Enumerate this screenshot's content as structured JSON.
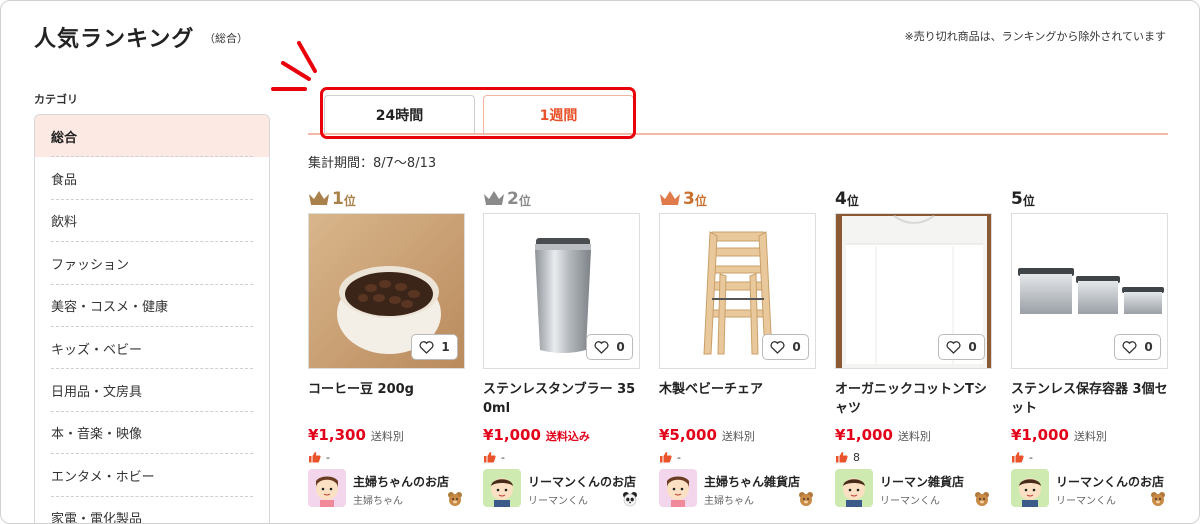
{
  "header": {
    "title": "人気ランキング",
    "subtitle": "（総合）",
    "notice": "※売り切れ商品は、ランキングから除外されています"
  },
  "sidebar": {
    "heading": "カテゴリ",
    "items": [
      {
        "label": "総合",
        "active": true
      },
      {
        "label": "食品"
      },
      {
        "label": "飲料"
      },
      {
        "label": "ファッション"
      },
      {
        "label": "美容・コスメ・健康"
      },
      {
        "label": "キッズ・ベビー"
      },
      {
        "label": "日用品・文房具"
      },
      {
        "label": "本・音楽・映像"
      },
      {
        "label": "エンタメ・ホビー"
      },
      {
        "label": "家電・電化製品"
      }
    ]
  },
  "tabs": [
    {
      "label": "24時間",
      "active": false
    },
    {
      "label": "1週間",
      "active": true
    }
  ],
  "period": "集計期間：8/7〜8/13",
  "products": [
    {
      "rank": "1",
      "rank_suffix": "位",
      "crown": "gold",
      "name": "コーヒー豆 200g",
      "likes": "1",
      "price": "¥1,300",
      "shipping": "送料別",
      "shipping_included": false,
      "rating": "-",
      "shop_name": "主婦ちゃんのお店",
      "shop_owner": "主婦ちゃん",
      "image": "coffee-beans-bowl",
      "avatar_bg": "#f3d6ec"
    },
    {
      "rank": "2",
      "rank_suffix": "位",
      "crown": "silver",
      "name": "ステンレスタンブラー 350ml",
      "likes": "0",
      "price": "¥1,000",
      "shipping": "送料込み",
      "shipping_included": true,
      "rating": "-",
      "shop_name": "リーマンくんのお店",
      "shop_owner": "リーマンくん",
      "image": "stainless-tumbler",
      "avatar_bg": "#cfeab0"
    },
    {
      "rank": "3",
      "rank_suffix": "位",
      "crown": "bronze",
      "name": "木製ベビーチェア",
      "likes": "0",
      "price": "¥5,000",
      "shipping": "送料別",
      "shipping_included": false,
      "rating": "-",
      "shop_name": "主婦ちゃん雑貨店",
      "shop_owner": "主婦ちゃん",
      "image": "wooden-baby-chair",
      "avatar_bg": "#f3d6ec"
    },
    {
      "rank": "4",
      "rank_suffix": "位",
      "crown": "none",
      "name": "オーガニックコットンTシャツ",
      "likes": "0",
      "price": "¥1,000",
      "shipping": "送料別",
      "shipping_included": false,
      "rating": "8",
      "shop_name": "リーマン雑貨店",
      "shop_owner": "リーマンくん",
      "image": "white-tshirt",
      "avatar_bg": "#cfeab0"
    },
    {
      "rank": "5",
      "rank_suffix": "位",
      "crown": "none",
      "name": "ステンレス保存容器 3個セット",
      "likes": "0",
      "price": "¥1,000",
      "shipping": "送料別",
      "shipping_included": false,
      "rating": "-",
      "shop_name": "リーマンくんのお店",
      "shop_owner": "リーマンくん",
      "image": "stainless-containers",
      "avatar_bg": "#cfeab0"
    }
  ],
  "colors": {
    "accent": "#e8532b",
    "highlight": "#e8000b",
    "price": "#e2001a",
    "active_category_bg": "#fde9e3",
    "gold": "#a9814a",
    "silver": "#8a8a8a",
    "bronze": "#c9702e"
  },
  "icons": {
    "crown": "crown-icon",
    "like": "heart-icon",
    "rating": "thumbs-up-icon",
    "emphasis": "attention-spark-icon"
  }
}
